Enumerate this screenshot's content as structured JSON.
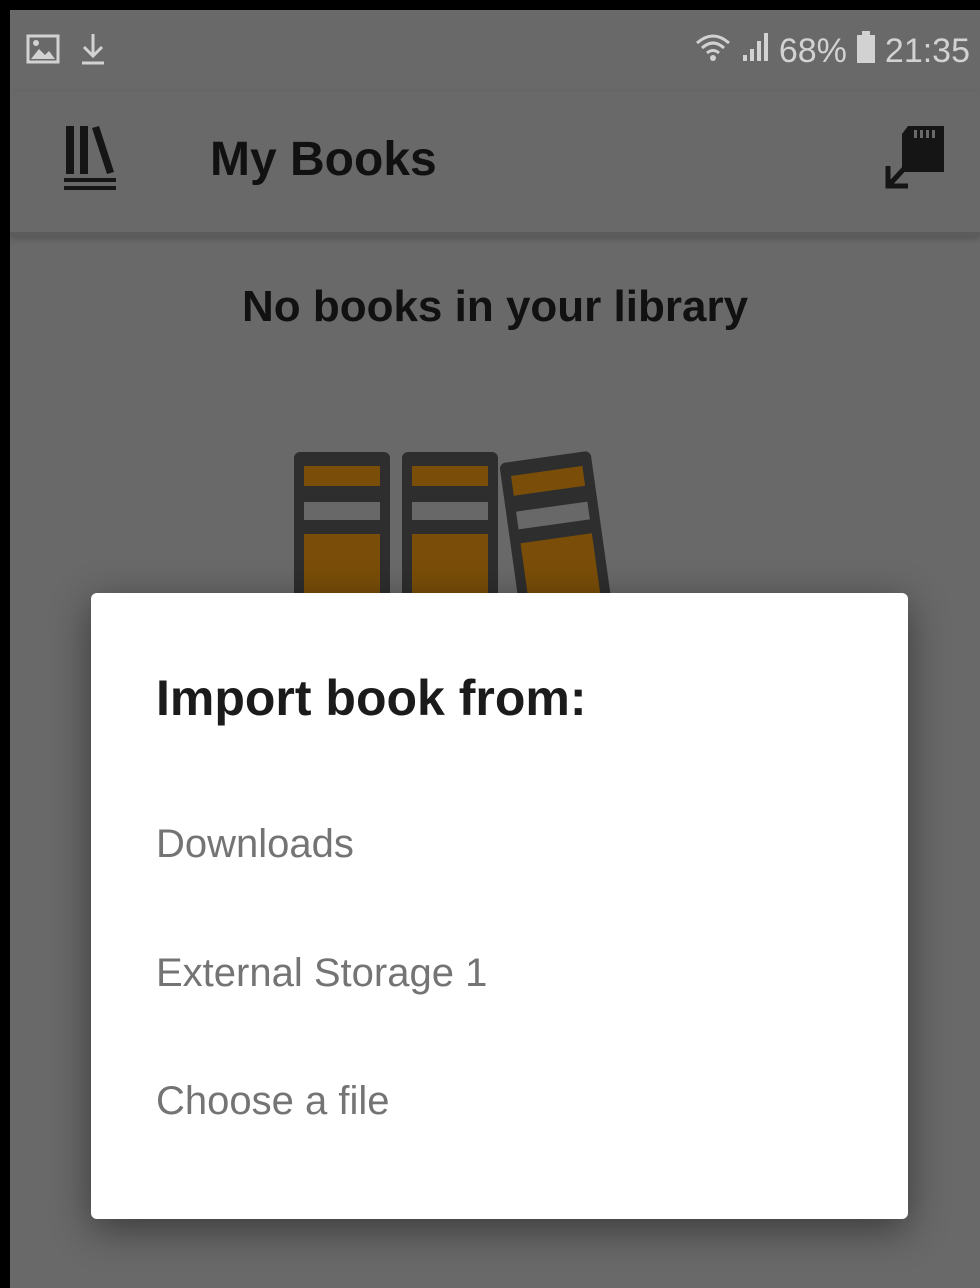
{
  "status_bar": {
    "icons_left": [
      "gallery-icon",
      "download-icon"
    ],
    "icons_right": [
      "wifi-icon",
      "signal-icon",
      "battery-icon"
    ],
    "battery": "68%",
    "time": "21:35"
  },
  "app_bar": {
    "title": "My Books",
    "logo_icon": "library-icon",
    "action_icon": "sd-card-import-icon"
  },
  "library": {
    "empty_message": "No books in your library",
    "illustration": "books-icon"
  },
  "dialog": {
    "title": "Import book from:",
    "options": [
      {
        "label": "Downloads"
      },
      {
        "label": "External Storage 1"
      },
      {
        "label": "Choose a file"
      }
    ]
  },
  "colors": {
    "background_dimmed": "#696969",
    "book_fill": "#7a4e08",
    "book_outline": "#2e2e2e",
    "dialog_bg": "#ffffff",
    "option_text": "#747474"
  }
}
